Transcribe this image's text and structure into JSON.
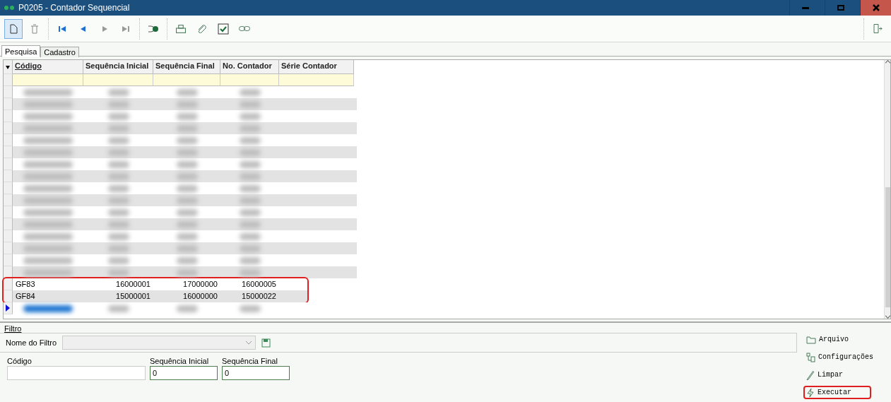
{
  "window": {
    "title": "P0205 - Contador Sequencial"
  },
  "tabs": [
    {
      "label": "Pesquisa",
      "selected": true
    },
    {
      "label": "Cadastro",
      "selected": false
    }
  ],
  "table": {
    "columns": [
      "Código",
      "Sequência Inicial",
      "Sequência Final",
      "No. Contador",
      "Série Contador"
    ],
    "rows": [
      {
        "kind": "blurred",
        "selected": false
      },
      {
        "kind": "blurred",
        "selected": false
      },
      {
        "kind": "blurred",
        "selected": false
      },
      {
        "kind": "blurred",
        "selected": false
      },
      {
        "kind": "blurred",
        "selected": false
      },
      {
        "kind": "blurred",
        "selected": false
      },
      {
        "kind": "blurred",
        "selected": false
      },
      {
        "kind": "blurred",
        "selected": false
      },
      {
        "kind": "blurred",
        "selected": false
      },
      {
        "kind": "blurred",
        "selected": false
      },
      {
        "kind": "blurred",
        "selected": false
      },
      {
        "kind": "blurred",
        "selected": false
      },
      {
        "kind": "blurred",
        "selected": false
      },
      {
        "kind": "blurred",
        "selected": false
      },
      {
        "kind": "blurred",
        "selected": false
      },
      {
        "kind": "blurred",
        "selected": false
      },
      {
        "kind": "data",
        "selected": false,
        "highlighted": true,
        "cells": [
          "GF83",
          "16000001",
          "17000000",
          "16000005"
        ]
      },
      {
        "kind": "data",
        "selected": false,
        "highlighted": true,
        "cells": [
          "GF84",
          "15000001",
          "16000000",
          "15000022"
        ]
      },
      {
        "kind": "blurred",
        "selected": true
      }
    ]
  },
  "filter": {
    "title": "Filtro",
    "name_label": "Nome do Filtro",
    "fields": [
      {
        "label": "Código"
      },
      {
        "label": "Sequência Inicial",
        "value": "0"
      },
      {
        "label": "Sequência Final",
        "value": "0"
      }
    ]
  },
  "actions": [
    {
      "label": "Arquivo",
      "highlighted": false
    },
    {
      "label": "Configurações",
      "highlighted": false
    },
    {
      "label": "Limpar",
      "highlighted": false
    },
    {
      "label": "Executar",
      "highlighted": true
    }
  ]
}
